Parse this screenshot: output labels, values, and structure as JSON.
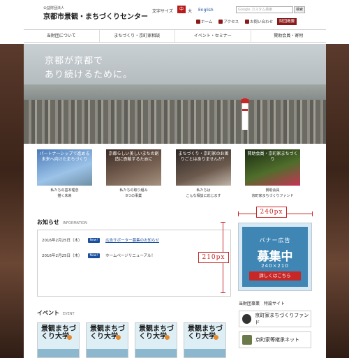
{
  "header": {
    "org_small": "公益財団法人",
    "org_name": "京都市景観・まちづくりセンター",
    "font_size_label": "文字サイズ",
    "font_size_mid": "中",
    "font_size_large": "大",
    "language": "English",
    "search_placeholder": "Google カスタム検索",
    "search_button": "検索",
    "quick_links": [
      "ホーム",
      "アクセス",
      "お問い合わせ",
      "財団概要"
    ]
  },
  "nav": [
    "当財団について",
    "まちづくり・京町家相談",
    "イベント・セミナー",
    "賛助会員・寄附"
  ],
  "hero": {
    "line1": "京都が京都で",
    "line2": "あり続けるために。"
  },
  "cards": [
    {
      "caption": "パートナーシップで進める未来へ向けたまちづくり",
      "text1": "私たちの基本理念",
      "text2": "描く未来"
    },
    {
      "caption": "京都らしい美しいまちの創造に貢献するために",
      "text1": "私たちの取り組み",
      "text2": "8つの事業"
    },
    {
      "caption": "まちづくり・京町家のお困りごとはありませんか？",
      "text1": "私たちは",
      "text2": "こんな相談に応じます"
    },
    {
      "caption": "賛助会員・京町家まちづくり",
      "text1": "賛助会員",
      "text2": "京町家まちづくりファンド"
    }
  ],
  "news": {
    "title": "お知らせ",
    "subtitle": "INFORMATION",
    "items": [
      {
        "date": "2016年2月25日（木）",
        "badge": "New!",
        "text": "広告サポーター募集のお知らせ"
      },
      {
        "date": "2016年2月25日（木）",
        "badge": "New!",
        "text": "ホームページリニューアル！"
      }
    ]
  },
  "banner": {
    "line1": "バナー広告",
    "line2": "募集中",
    "line3": "240×210",
    "button": "詳しくはこちら"
  },
  "dims": {
    "width_label": "240px",
    "height_label": "210px"
  },
  "sites": {
    "title": "当財団事業　特設サイト",
    "items": [
      "京町家まちづくりファンド",
      "京町家等継承ネット"
    ]
  },
  "events": {
    "title": "イベント",
    "subtitle": "EVENT",
    "card_text": "景観まちづくり大学"
  },
  "colors": {
    "accent": "#b71c1c",
    "link": "#1a4fa0",
    "banner": "#3f86b5"
  }
}
